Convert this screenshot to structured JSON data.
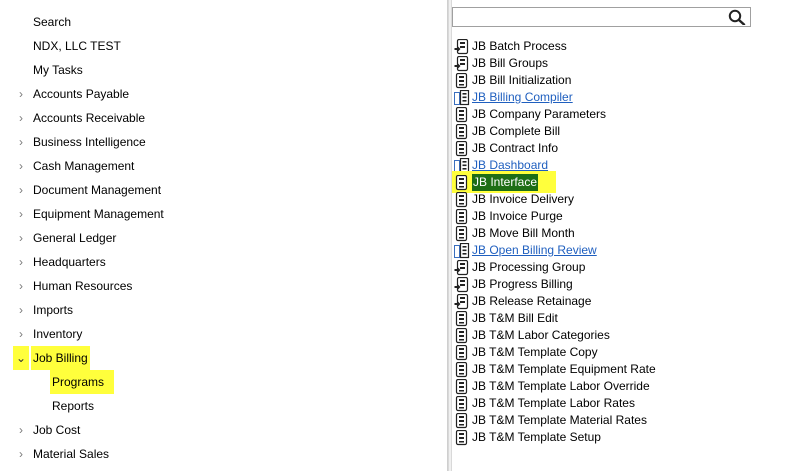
{
  "left_nav": {
    "items": [
      {
        "label": "Search"
      },
      {
        "label": "NDX, LLC TEST"
      },
      {
        "label": "My Tasks"
      },
      {
        "label": "Accounts Payable"
      },
      {
        "label": "Accounts Receivable"
      },
      {
        "label": "Business Intelligence"
      },
      {
        "label": "Cash Management"
      },
      {
        "label": "Document Management"
      },
      {
        "label": "Equipment Management"
      },
      {
        "label": "General Ledger"
      },
      {
        "label": "Headquarters"
      },
      {
        "label": "Human Resources"
      },
      {
        "label": "Imports"
      },
      {
        "label": "Inventory"
      },
      {
        "label": "Job Billing"
      },
      {
        "label": "Programs"
      },
      {
        "label": "Reports"
      },
      {
        "label": "Job Cost"
      },
      {
        "label": "Material Sales"
      }
    ]
  },
  "search": {
    "placeholder": "",
    "value": ""
  },
  "programs": [
    {
      "label": "JB Batch Process",
      "icon": "batch-form-icon"
    },
    {
      "label": "JB Bill Groups",
      "icon": "batch-form-icon"
    },
    {
      "label": "JB Bill Initialization",
      "icon": "form-icon"
    },
    {
      "label": "JB Billing Compiler",
      "icon": "report-link-icon"
    },
    {
      "label": "JB Company Parameters",
      "icon": "form-icon"
    },
    {
      "label": "JB Complete Bill",
      "icon": "form-icon"
    },
    {
      "label": "JB Contract Info",
      "icon": "form-icon"
    },
    {
      "label": "JB Dashboard",
      "icon": "report-link-icon"
    },
    {
      "label": "JB Interface",
      "icon": "form-icon"
    },
    {
      "label": "JB Invoice Delivery",
      "icon": "form-icon"
    },
    {
      "label": "JB Invoice Purge",
      "icon": "form-icon"
    },
    {
      "label": "JB Move Bill Month",
      "icon": "form-icon"
    },
    {
      "label": "JB Open Billing Review",
      "icon": "report-link-icon"
    },
    {
      "label": "JB Processing Group",
      "icon": "batch-form-icon"
    },
    {
      "label": "JB Progress Billing",
      "icon": "batch-form-icon"
    },
    {
      "label": "JB Release Retainage",
      "icon": "batch-form-icon"
    },
    {
      "label": "JB T&M Bill Edit",
      "icon": "form-icon"
    },
    {
      "label": "JB T&M Labor Categories",
      "icon": "form-icon"
    },
    {
      "label": "JB T&M Template Copy",
      "icon": "form-icon"
    },
    {
      "label": "JB T&M Template Equipment Rate",
      "icon": "form-icon"
    },
    {
      "label": "JB T&M Template Labor Override",
      "icon": "form-icon"
    },
    {
      "label": "JB T&M Template Labor Rates",
      "icon": "form-icon"
    },
    {
      "label": "JB T&M Template Material Rates",
      "icon": "form-icon"
    },
    {
      "label": "JB T&M Template Setup",
      "icon": "form-icon"
    }
  ],
  "colors": {
    "highlight": "#ffff3c",
    "selected": "#1e6e16",
    "link": "#1f5fbf"
  }
}
